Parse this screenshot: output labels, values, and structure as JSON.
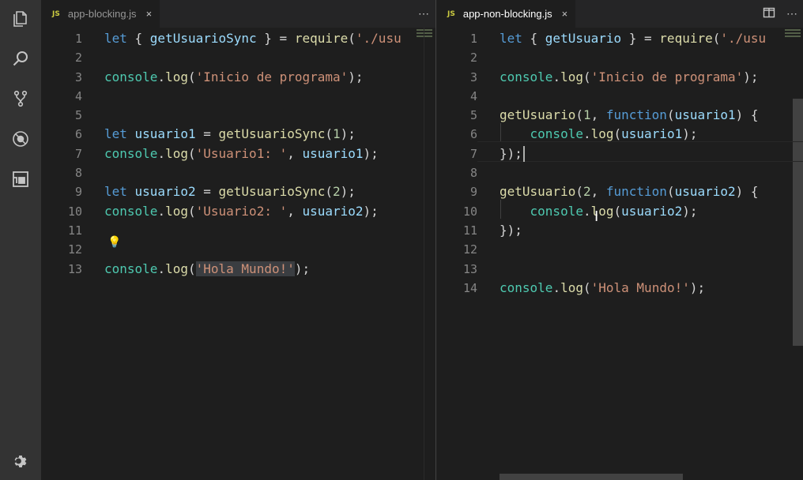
{
  "left_editor": {
    "tab": {
      "filename": "app-blocking.js",
      "badge": "JS",
      "close": "×"
    },
    "more": "⋯",
    "lines": [
      {
        "n": "1",
        "tokens": [
          [
            "kw",
            "let "
          ],
          [
            "punc",
            "{ "
          ],
          [
            "var",
            "getUsuarioSync"
          ],
          [
            "punc",
            " } = "
          ],
          [
            "fn",
            "require"
          ],
          [
            "punc",
            "("
          ],
          [
            "str",
            "'./usu"
          ]
        ]
      },
      {
        "n": "2",
        "tokens": []
      },
      {
        "n": "3",
        "tokens": [
          [
            "obj",
            "console"
          ],
          [
            "punc",
            "."
          ],
          [
            "fn",
            "log"
          ],
          [
            "punc",
            "("
          ],
          [
            "str",
            "'Inicio de programa'"
          ],
          [
            "punc",
            ");"
          ]
        ]
      },
      {
        "n": "4",
        "tokens": []
      },
      {
        "n": "5",
        "tokens": []
      },
      {
        "n": "6",
        "tokens": [
          [
            "kw",
            "let "
          ],
          [
            "var",
            "usuario1"
          ],
          [
            "punc",
            " = "
          ],
          [
            "fn",
            "getUsuarioSync"
          ],
          [
            "punc",
            "("
          ],
          [
            "num",
            "1"
          ],
          [
            "punc",
            ");"
          ]
        ]
      },
      {
        "n": "7",
        "tokens": [
          [
            "obj",
            "console"
          ],
          [
            "punc",
            "."
          ],
          [
            "fn",
            "log"
          ],
          [
            "punc",
            "("
          ],
          [
            "str",
            "'Usuario1: '"
          ],
          [
            "punc",
            ", "
          ],
          [
            "var",
            "usuario1"
          ],
          [
            "punc",
            ");"
          ]
        ]
      },
      {
        "n": "8",
        "tokens": []
      },
      {
        "n": "9",
        "tokens": [
          [
            "kw",
            "let "
          ],
          [
            "var",
            "usuario2"
          ],
          [
            "punc",
            " = "
          ],
          [
            "fn",
            "getUsuarioSync"
          ],
          [
            "punc",
            "("
          ],
          [
            "num",
            "2"
          ],
          [
            "punc",
            ");"
          ]
        ]
      },
      {
        "n": "10",
        "tokens": [
          [
            "obj",
            "console"
          ],
          [
            "punc",
            "."
          ],
          [
            "fn",
            "log"
          ],
          [
            "punc",
            "("
          ],
          [
            "str",
            "'Usuario2: '"
          ],
          [
            "punc",
            ", "
          ],
          [
            "var",
            "usuario2"
          ],
          [
            "punc",
            ");"
          ]
        ]
      },
      {
        "n": "11",
        "tokens": []
      },
      {
        "n": "12",
        "tokens": []
      },
      {
        "n": "13",
        "tokens": [
          [
            "obj",
            "console"
          ],
          [
            "punc",
            "."
          ],
          [
            "fn",
            "log"
          ],
          [
            "punc",
            "("
          ],
          [
            "str",
            "'Hola Mundo!'"
          ],
          [
            "punc",
            ");"
          ]
        ]
      }
    ]
  },
  "right_editor": {
    "tab": {
      "filename": "app-non-blocking.js",
      "badge": "JS",
      "close": "×"
    },
    "more": "⋯",
    "lines": [
      {
        "n": "1",
        "tokens": [
          [
            "kw",
            "let "
          ],
          [
            "punc",
            "{ "
          ],
          [
            "var",
            "getUsuario"
          ],
          [
            "punc",
            " } = "
          ],
          [
            "fn",
            "require"
          ],
          [
            "punc",
            "("
          ],
          [
            "str",
            "'./usu"
          ]
        ]
      },
      {
        "n": "2",
        "tokens": []
      },
      {
        "n": "3",
        "tokens": [
          [
            "obj",
            "console"
          ],
          [
            "punc",
            "."
          ],
          [
            "fn",
            "log"
          ],
          [
            "punc",
            "("
          ],
          [
            "str",
            "'Inicio de programa'"
          ],
          [
            "punc",
            ");"
          ]
        ]
      },
      {
        "n": "4",
        "tokens": []
      },
      {
        "n": "5",
        "tokens": [
          [
            "fn",
            "getUsuario"
          ],
          [
            "punc",
            "("
          ],
          [
            "num",
            "1"
          ],
          [
            "punc",
            ", "
          ],
          [
            "kw",
            "function"
          ],
          [
            "punc",
            "("
          ],
          [
            "var",
            "usuario1"
          ],
          [
            "punc",
            ") {"
          ]
        ]
      },
      {
        "n": "6",
        "tokens": [
          [
            "punc",
            "    "
          ],
          [
            "obj",
            "console"
          ],
          [
            "punc",
            "."
          ],
          [
            "fn",
            "log"
          ],
          [
            "punc",
            "("
          ],
          [
            "var",
            "usuario1"
          ],
          [
            "punc",
            ");"
          ]
        ]
      },
      {
        "n": "7",
        "tokens": [
          [
            "punc",
            "});"
          ]
        ]
      },
      {
        "n": "8",
        "tokens": []
      },
      {
        "n": "9",
        "tokens": [
          [
            "fn",
            "getUsuario"
          ],
          [
            "punc",
            "("
          ],
          [
            "num",
            "2"
          ],
          [
            "punc",
            ", "
          ],
          [
            "kw",
            "function"
          ],
          [
            "punc",
            "("
          ],
          [
            "var",
            "usuario2"
          ],
          [
            "punc",
            ") {"
          ]
        ]
      },
      {
        "n": "10",
        "tokens": [
          [
            "punc",
            "    "
          ],
          [
            "obj",
            "console"
          ],
          [
            "punc",
            "."
          ],
          [
            "fn",
            "log"
          ],
          [
            "punc",
            "("
          ],
          [
            "var",
            "usuario2"
          ],
          [
            "punc",
            ");"
          ]
        ]
      },
      {
        "n": "11",
        "tokens": [
          [
            "punc",
            "});"
          ]
        ]
      },
      {
        "n": "12",
        "tokens": []
      },
      {
        "n": "13",
        "tokens": []
      },
      {
        "n": "14",
        "tokens": [
          [
            "obj",
            "console"
          ],
          [
            "punc",
            "."
          ],
          [
            "fn",
            "log"
          ],
          [
            "punc",
            "("
          ],
          [
            "str",
            "'Hola Mundo!'"
          ],
          [
            "punc",
            ");"
          ]
        ]
      }
    ]
  },
  "activity_bar": {
    "icons": [
      "explorer-icon",
      "search-icon",
      "source-control-icon",
      "debug-icon",
      "extensions-icon",
      "gear-icon"
    ]
  }
}
